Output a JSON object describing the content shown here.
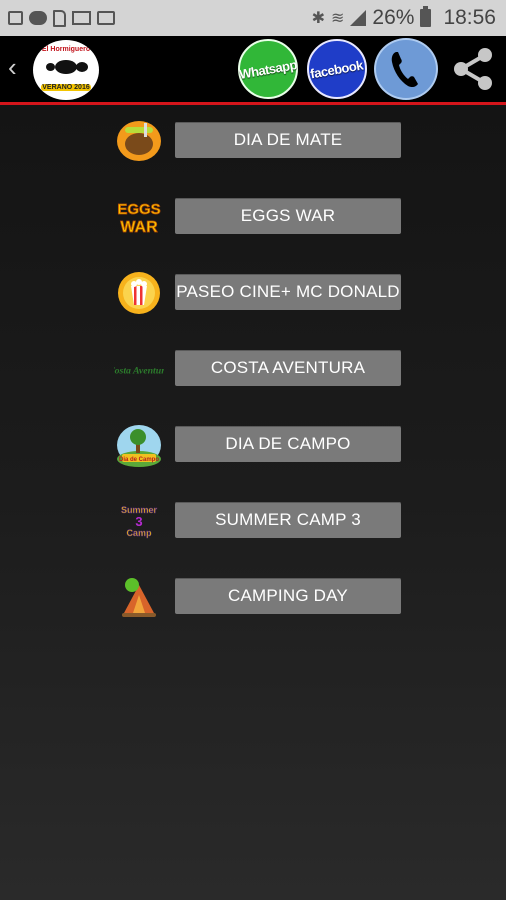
{
  "status_bar": {
    "battery": "26%",
    "time": "18:56"
  },
  "toolbar": {
    "back_icon": "chevron-left-icon",
    "logo_top": "El Hormiguero",
    "logo_bottom": "VERANO 2016",
    "whatsapp_label": "Whatsapp",
    "facebook_label": "facebook",
    "phone_icon": "phone-icon",
    "share_icon": "share-icon",
    "accent_color": "#d4151b"
  },
  "list": {
    "items": [
      {
        "label": "DIA DE MATE",
        "icon": "mate-icon"
      },
      {
        "label": "EGGS WAR",
        "icon": "eggs-war-logo",
        "logo_text": "EGGS WAR"
      },
      {
        "label": "PASEO CINE+  MC DONALD",
        "icon": "popcorn-icon"
      },
      {
        "label": "COSTA AVENTURA",
        "icon": "costa-aventura-logo",
        "logo_text": "Costa Aventura"
      },
      {
        "label": "DIA DE CAMPO",
        "icon": "campo-icon",
        "logo_text": "Dia de Campo"
      },
      {
        "label": "SUMMER CAMP 3",
        "icon": "summer-camp-logo",
        "logo_text": "Summer Camp"
      },
      {
        "label": "CAMPING DAY",
        "icon": "camping-icon"
      }
    ]
  }
}
